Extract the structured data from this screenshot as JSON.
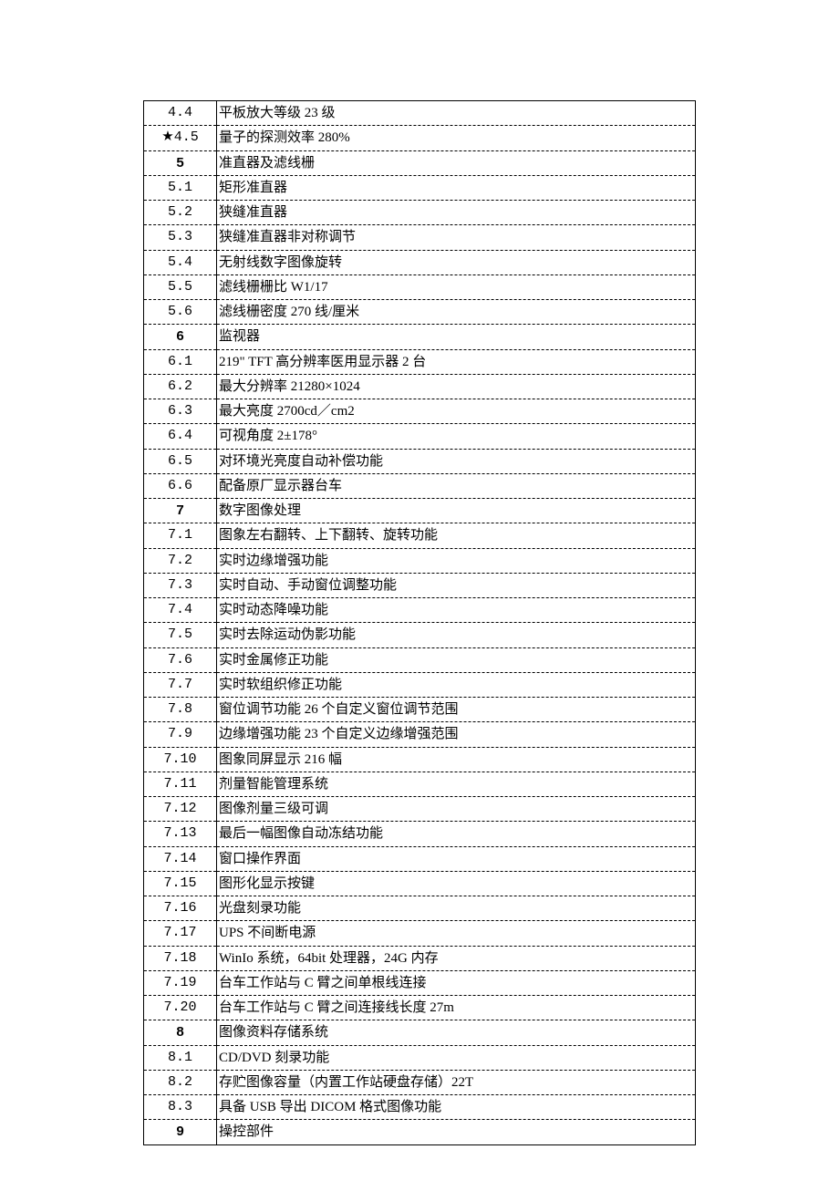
{
  "rows": [
    {
      "num": "4.4",
      "desc": "平板放大等级 23 级",
      "header": false
    },
    {
      "num": "★4.5",
      "desc": "量子的探测效率 280%",
      "header": false
    },
    {
      "num": "5",
      "desc": "准直器及滤线栅",
      "header": true
    },
    {
      "num": "5.1",
      "desc": "矩形准直器",
      "header": false
    },
    {
      "num": "5.2",
      "desc": "狭缝准直器",
      "header": false
    },
    {
      "num": "5.3",
      "desc": "狭缝准直器非对称调节",
      "header": false
    },
    {
      "num": "5.4",
      "desc": "无射线数字图像旋转",
      "header": false
    },
    {
      "num": "5.5",
      "desc": "滤线栅栅比 W1/17",
      "header": false
    },
    {
      "num": "5.6",
      "desc": "滤线栅密度 270 线/厘米",
      "header": false
    },
    {
      "num": "6",
      "desc": "监视器",
      "header": true
    },
    {
      "num": "6.1",
      "desc": "219\" TFT 高分辨率医用显示器 2 台",
      "header": false
    },
    {
      "num": "6.2",
      "desc": "最大分辨率 21280×1024",
      "header": false
    },
    {
      "num": "6.3",
      "desc": "最大亮度 2700cd／cm2",
      "header": false
    },
    {
      "num": "6.4",
      "desc": "可视角度 2±178°",
      "header": false
    },
    {
      "num": "6.5",
      "desc": "对环境光亮度自动补偿功能",
      "header": false
    },
    {
      "num": "6.6",
      "desc": "配备原厂显示器台车",
      "header": false
    },
    {
      "num": "7",
      "desc": "数字图像处理",
      "header": true
    },
    {
      "num": "7.1",
      "desc": "图象左右翻转、上下翻转、旋转功能",
      "header": false
    },
    {
      "num": "7.2",
      "desc": "实时边缘增强功能",
      "header": false
    },
    {
      "num": "7.3",
      "desc": "实时自动、手动窗位调整功能",
      "header": false
    },
    {
      "num": "7.4",
      "desc": "实时动态降噪功能",
      "header": false
    },
    {
      "num": "7.5",
      "desc": "实时去除运动伪影功能",
      "header": false
    },
    {
      "num": "7.6",
      "desc": "实时金属修正功能",
      "header": false
    },
    {
      "num": "7.7",
      "desc": "实时软组织修正功能",
      "header": false
    },
    {
      "num": "7.8",
      "desc": "窗位调节功能 26 个自定义窗位调节范围",
      "header": false
    },
    {
      "num": "7.9",
      "desc": "边缘增强功能 23 个自定义边缘增强范围",
      "header": false
    },
    {
      "num": "7.10",
      "desc": "图象同屏显示 216 幅",
      "header": false
    },
    {
      "num": "7.11",
      "desc": "剂量智能管理系统",
      "header": false
    },
    {
      "num": "7.12",
      "desc": "图像剂量三级可调",
      "header": false
    },
    {
      "num": "7.13",
      "desc": "最后一幅图像自动冻结功能",
      "header": false
    },
    {
      "num": "7.14",
      "desc": "窗口操作界面",
      "header": false
    },
    {
      "num": "7.15",
      "desc": "图形化显示按键",
      "header": false
    },
    {
      "num": "7.16",
      "desc": "光盘刻录功能",
      "header": false
    },
    {
      "num": "7.17",
      "desc": "UPS 不间断电源",
      "header": false
    },
    {
      "num": "7.18",
      "desc": "WinIo 系统，64bit 处理器，24G 内存",
      "header": false
    },
    {
      "num": "7.19",
      "desc": "台车工作站与 C 臂之间单根线连接",
      "header": false
    },
    {
      "num": "7.20",
      "desc": "台车工作站与 C 臂之间连接线长度 27m",
      "header": false
    },
    {
      "num": "8",
      "desc": "图像资料存储系统",
      "header": true
    },
    {
      "num": "8.1",
      "desc": "CD/DVD 刻录功能",
      "header": false
    },
    {
      "num": "8.2",
      "desc": "存贮图像容量（内置工作站硬盘存储）22T",
      "header": false
    },
    {
      "num": "8.3",
      "desc": "具备 USB 导出 DICOM 格式图像功能",
      "header": false
    },
    {
      "num": "9",
      "desc": "操控部件",
      "header": true
    }
  ]
}
